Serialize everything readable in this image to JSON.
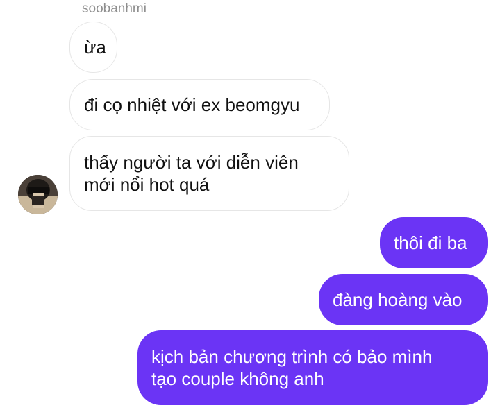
{
  "thread": {
    "sender_name": "soobanhmi",
    "avatar_icon": "user-avatar-photo",
    "colors": {
      "outgoing_bubble": "#6b34f5",
      "incoming_border": "#e6e6e6",
      "sender_name": "#8e8e8e"
    },
    "incoming": [
      {
        "text": "ừa"
      },
      {
        "text": "đi cọ nhiệt với ex beomgyu"
      },
      {
        "text": "thấy người ta với diễn viên\nmới nổi hot quá"
      }
    ],
    "outgoing": [
      {
        "text": "thôi đi ba"
      },
      {
        "text": "đàng hoàng vào"
      },
      {
        "text": "kịch bản chương trình có bảo mình\ntạo couple không anh"
      }
    ]
  }
}
